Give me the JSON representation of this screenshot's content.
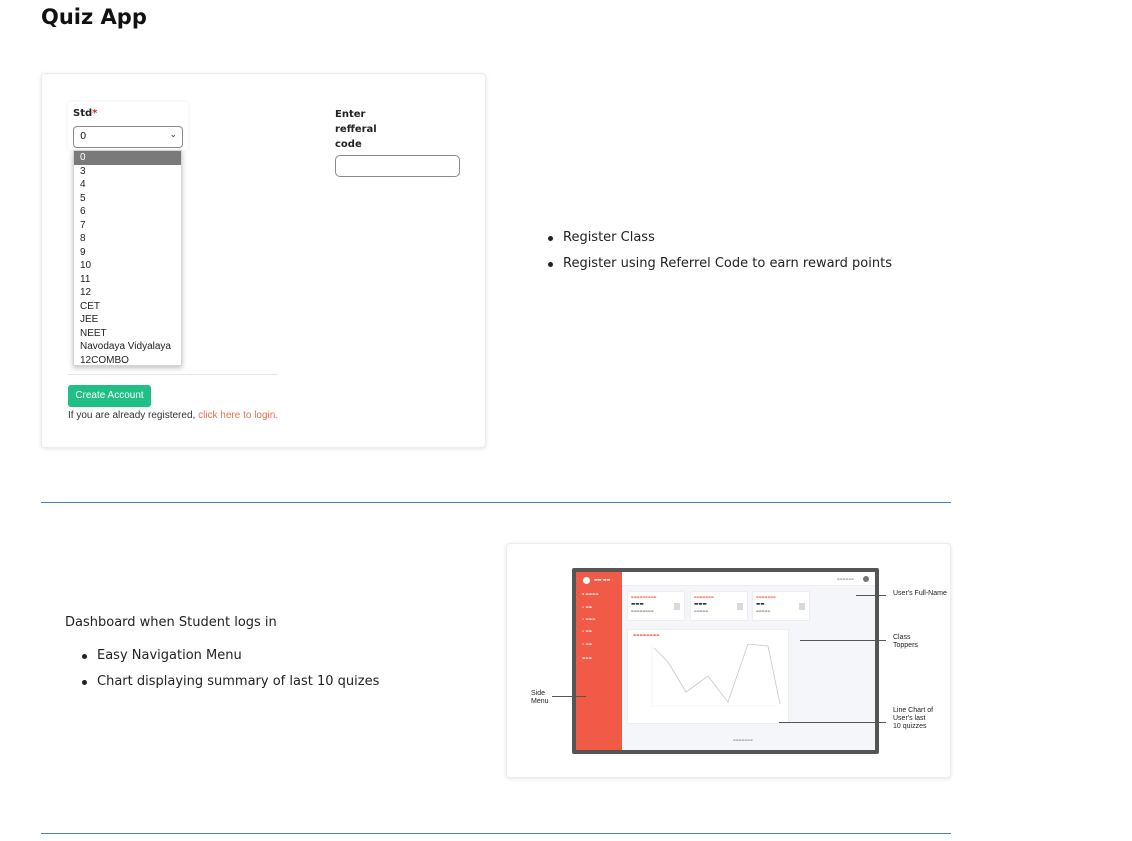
{
  "page": {
    "title": "Quiz App"
  },
  "registration": {
    "std_label": "Std",
    "required_mark": "*",
    "std_selected": "0",
    "std_options": [
      "0",
      "3",
      "4",
      "5",
      "6",
      "7",
      "8",
      "9",
      "10",
      "11",
      "12",
      "CET",
      "JEE",
      "NEET",
      "Navodaya Vidyalaya",
      "12COMBO"
    ],
    "referral_label": "Enter refferal code",
    "referral_value": "",
    "create_button": "Create Account",
    "login_prompt": "If you are already registered,",
    "login_link": "click here to login."
  },
  "features_1": [
    "Register Class",
    "Register using Referrel Code to earn reward points"
  ],
  "dashboard": {
    "intro": "Dashboard when Student logs in",
    "features": [
      "Easy Navigation Menu",
      "Chart displaying summary of last 10 quizes"
    ],
    "annotations": {
      "user": "User's Full-Name",
      "toppers": "Class Toppers",
      "chart": "Line Chart of User's last 10 quizzes",
      "menu": "Side Menu"
    }
  },
  "colors": {
    "accent_button": "#1fbf85",
    "link": "#e9704f",
    "sidebar": "#f25a48",
    "divider": "#4f7fc3"
  },
  "icons": {
    "select": "chevron-down-icon",
    "avatar": "user-icon",
    "logo": "app-logo-icon"
  }
}
